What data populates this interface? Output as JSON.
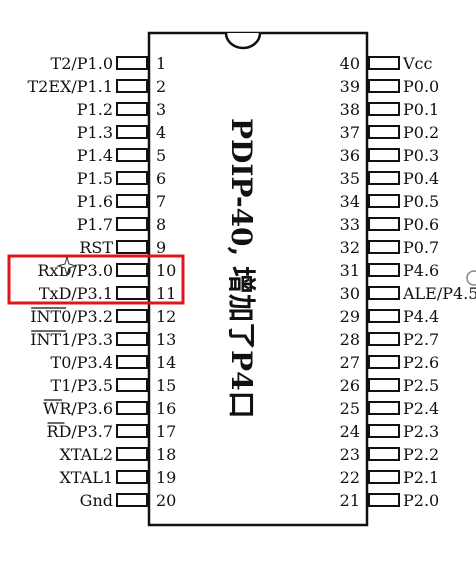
{
  "chip": {
    "title": "PDIP-40, 增加了P4口",
    "body_color": "#ffffff",
    "line_color": "#111111"
  },
  "left_pins": [
    {
      "num": "1",
      "label": "T2/P1.0"
    },
    {
      "num": "2",
      "label": "T2EX/P1.1"
    },
    {
      "num": "3",
      "label": "P1.2"
    },
    {
      "num": "4",
      "label": "P1.3"
    },
    {
      "num": "5",
      "label": "P1.4"
    },
    {
      "num": "6",
      "label": "P1.5"
    },
    {
      "num": "7",
      "label": "P1.6"
    },
    {
      "num": "8",
      "label": "P1.7"
    },
    {
      "num": "9",
      "label": "RST"
    },
    {
      "num": "10",
      "label": "RxD/P3.0"
    },
    {
      "num": "11",
      "label": "TxD/P3.1"
    },
    {
      "num": "12",
      "label": "INT0/P3.2",
      "overline": "INT0"
    },
    {
      "num": "13",
      "label": "INT1/P3.3",
      "overline": "INT1"
    },
    {
      "num": "14",
      "label": "T0/P3.4"
    },
    {
      "num": "15",
      "label": "T1/P3.5"
    },
    {
      "num": "16",
      "label": "WR/P3.6",
      "overline": "WR"
    },
    {
      "num": "17",
      "label": "RD/P3.7",
      "overline": "RD"
    },
    {
      "num": "18",
      "label": "XTAL2"
    },
    {
      "num": "19",
      "label": "XTAL1"
    },
    {
      "num": "20",
      "label": "Gnd"
    }
  ],
  "right_pins": [
    {
      "num": "40",
      "label": "Vcc"
    },
    {
      "num": "39",
      "label": "P0.0"
    },
    {
      "num": "38",
      "label": "P0.1"
    },
    {
      "num": "37",
      "label": "P0.2"
    },
    {
      "num": "36",
      "label": "P0.3"
    },
    {
      "num": "35",
      "label": "P0.4"
    },
    {
      "num": "34",
      "label": "P0.5"
    },
    {
      "num": "33",
      "label": "P0.6"
    },
    {
      "num": "32",
      "label": "P0.7"
    },
    {
      "num": "31",
      "label": "P4.6"
    },
    {
      "num": "30",
      "label": "ALE/P4.5"
    },
    {
      "num": "29",
      "label": "P4.4"
    },
    {
      "num": "28",
      "label": "P2.7"
    },
    {
      "num": "27",
      "label": "P2.6"
    },
    {
      "num": "26",
      "label": "P2.5"
    },
    {
      "num": "25",
      "label": "P2.4"
    },
    {
      "num": "24",
      "label": "P2.3"
    },
    {
      "num": "23",
      "label": "P2.2"
    },
    {
      "num": "22",
      "label": "P2.1"
    },
    {
      "num": "21",
      "label": "P2.0"
    }
  ],
  "highlight": {
    "pins": [
      "10",
      "11"
    ],
    "color": "#e0151b"
  }
}
